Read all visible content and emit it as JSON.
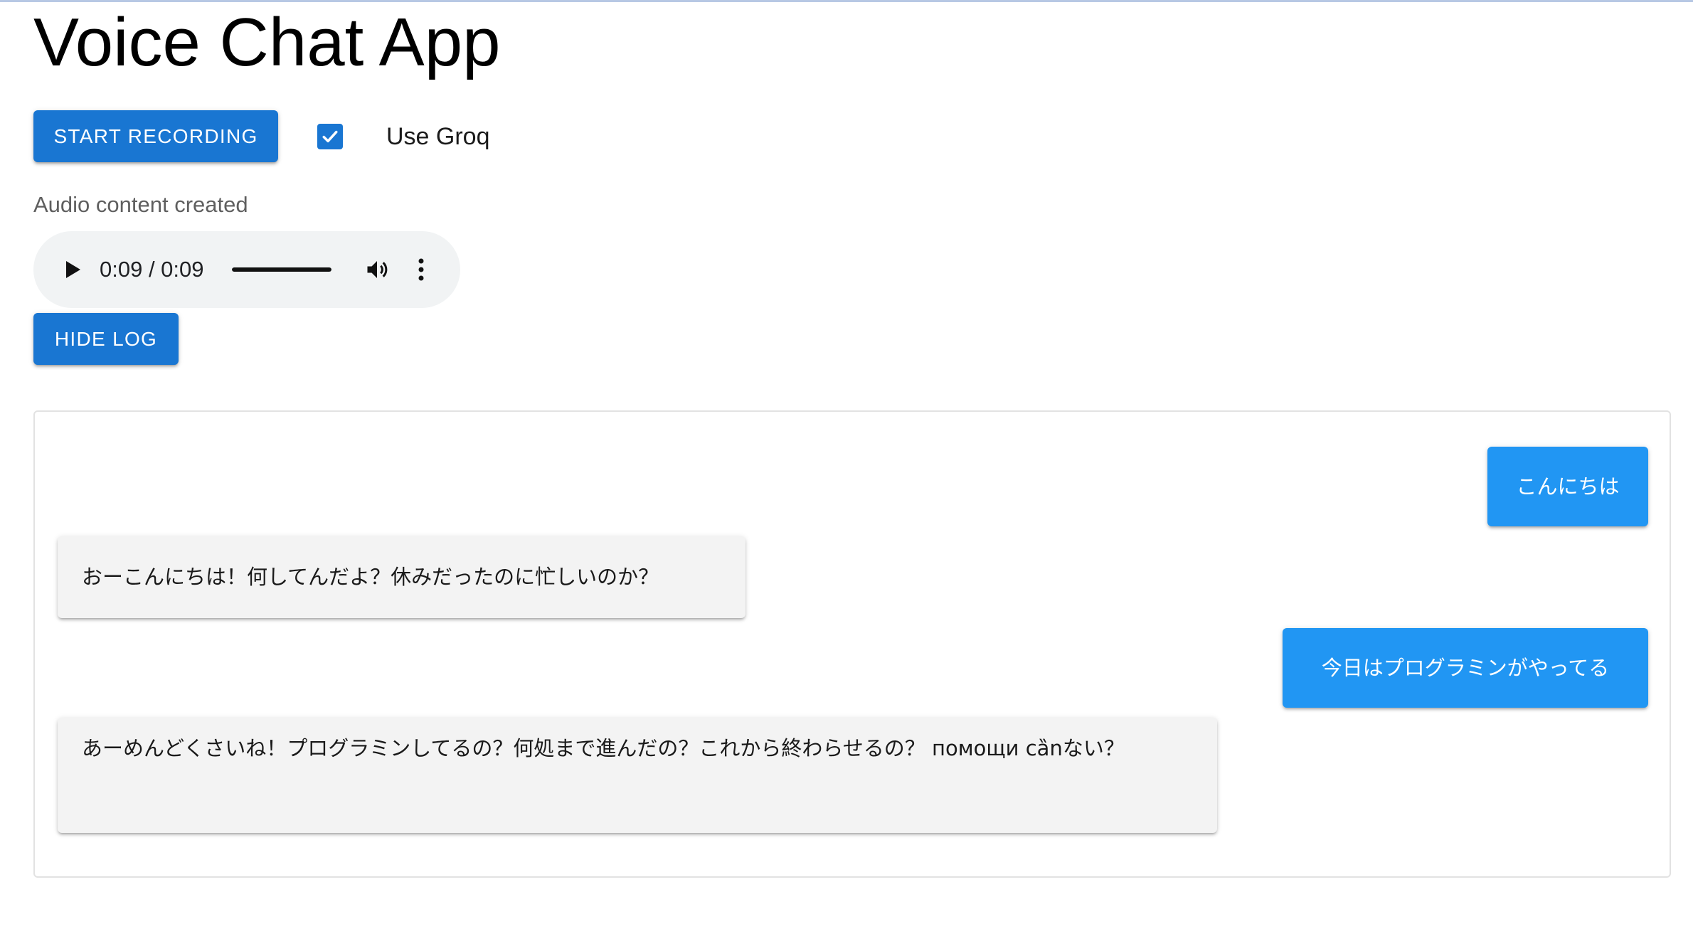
{
  "header": {
    "title": "Voice Chat App"
  },
  "controls": {
    "record_button_label": "START RECORDING",
    "use_groq_label": "Use Groq",
    "use_groq_checked": true,
    "status_text": "Audio content created",
    "hide_log_button_label": "HIDE LOG"
  },
  "audio_player": {
    "time_display": "0:09 / 0:09",
    "progress": 1.0,
    "play_icon": "play-icon",
    "volume_icon": "volume-icon",
    "more_icon": "more-vertical-icon"
  },
  "log": {
    "messages": [
      {
        "role": "user",
        "text": "こんにちは"
      },
      {
        "role": "assistant",
        "text": "おーこんにちは！何してんだよ？休みだったのに忙しいのか？"
      },
      {
        "role": "user",
        "text": "今日はプログラミンがやってる"
      },
      {
        "role": "assistant",
        "text": "あーめんどくさいね！プログラミンしてるの？何処まで進んだの？これから終わらせるの？ помощи cȁnない？"
      }
    ]
  },
  "colors": {
    "primary": "#1976d2",
    "user_bubble": "#2196f3",
    "assistant_bubble": "#f3f3f3"
  }
}
